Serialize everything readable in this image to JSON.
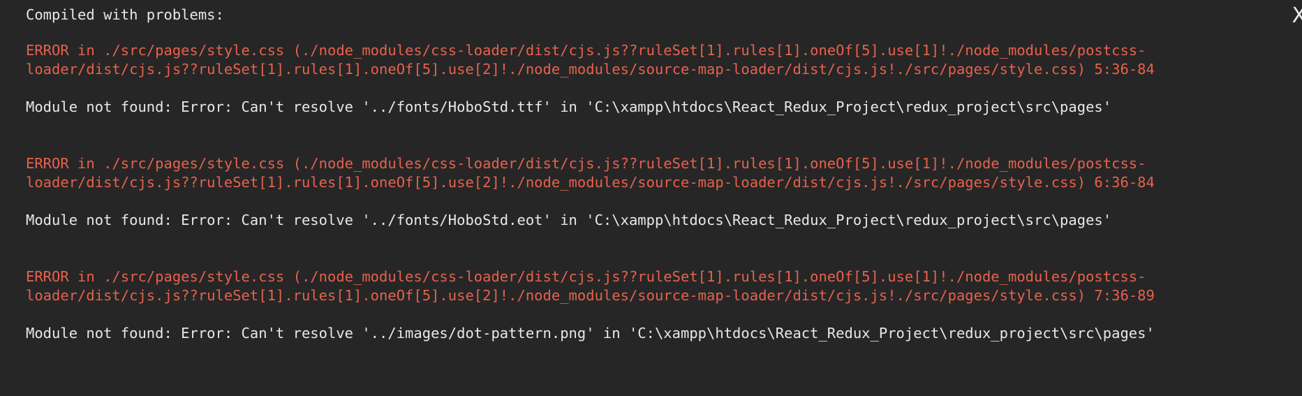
{
  "overlay": {
    "title": "Compiled with problems:",
    "close_label": "X",
    "colors": {
      "background": "#262626",
      "error_text": "#e8614c",
      "text": "#e8e8e8"
    },
    "errors": [
      {
        "header_line1": "ERROR in ./src/pages/style.css (./node_modules/css-loader/dist/cjs.js??ruleSet[1].rules[1].oneOf[5].use[1]!./node_modules/postcss-",
        "header_line2": "loader/dist/cjs.js??ruleSet[1].rules[1].oneOf[5].use[2]!./node_modules/source-map-loader/dist/cjs.js!./src/pages/style.css) 5:36-84",
        "message": "Module not found: Error: Can't resolve '../fonts/HoboStd.ttf' in 'C:\\xampp\\htdocs\\React_Redux_Project\\redux_project\\src\\pages'"
      },
      {
        "header_line1": "ERROR in ./src/pages/style.css (./node_modules/css-loader/dist/cjs.js??ruleSet[1].rules[1].oneOf[5].use[1]!./node_modules/postcss-",
        "header_line2": "loader/dist/cjs.js??ruleSet[1].rules[1].oneOf[5].use[2]!./node_modules/source-map-loader/dist/cjs.js!./src/pages/style.css) 6:36-84",
        "message": "Module not found: Error: Can't resolve '../fonts/HoboStd.eot' in 'C:\\xampp\\htdocs\\React_Redux_Project\\redux_project\\src\\pages'"
      },
      {
        "header_line1": "ERROR in ./src/pages/style.css (./node_modules/css-loader/dist/cjs.js??ruleSet[1].rules[1].oneOf[5].use[1]!./node_modules/postcss-",
        "header_line2": "loader/dist/cjs.js??ruleSet[1].rules[1].oneOf[5].use[2]!./node_modules/source-map-loader/dist/cjs.js!./src/pages/style.css) 7:36-89",
        "message": "Module not found: Error: Can't resolve '../images/dot-pattern.png' in 'C:\\xampp\\htdocs\\React_Redux_Project\\redux_project\\src\\pages'"
      }
    ]
  }
}
